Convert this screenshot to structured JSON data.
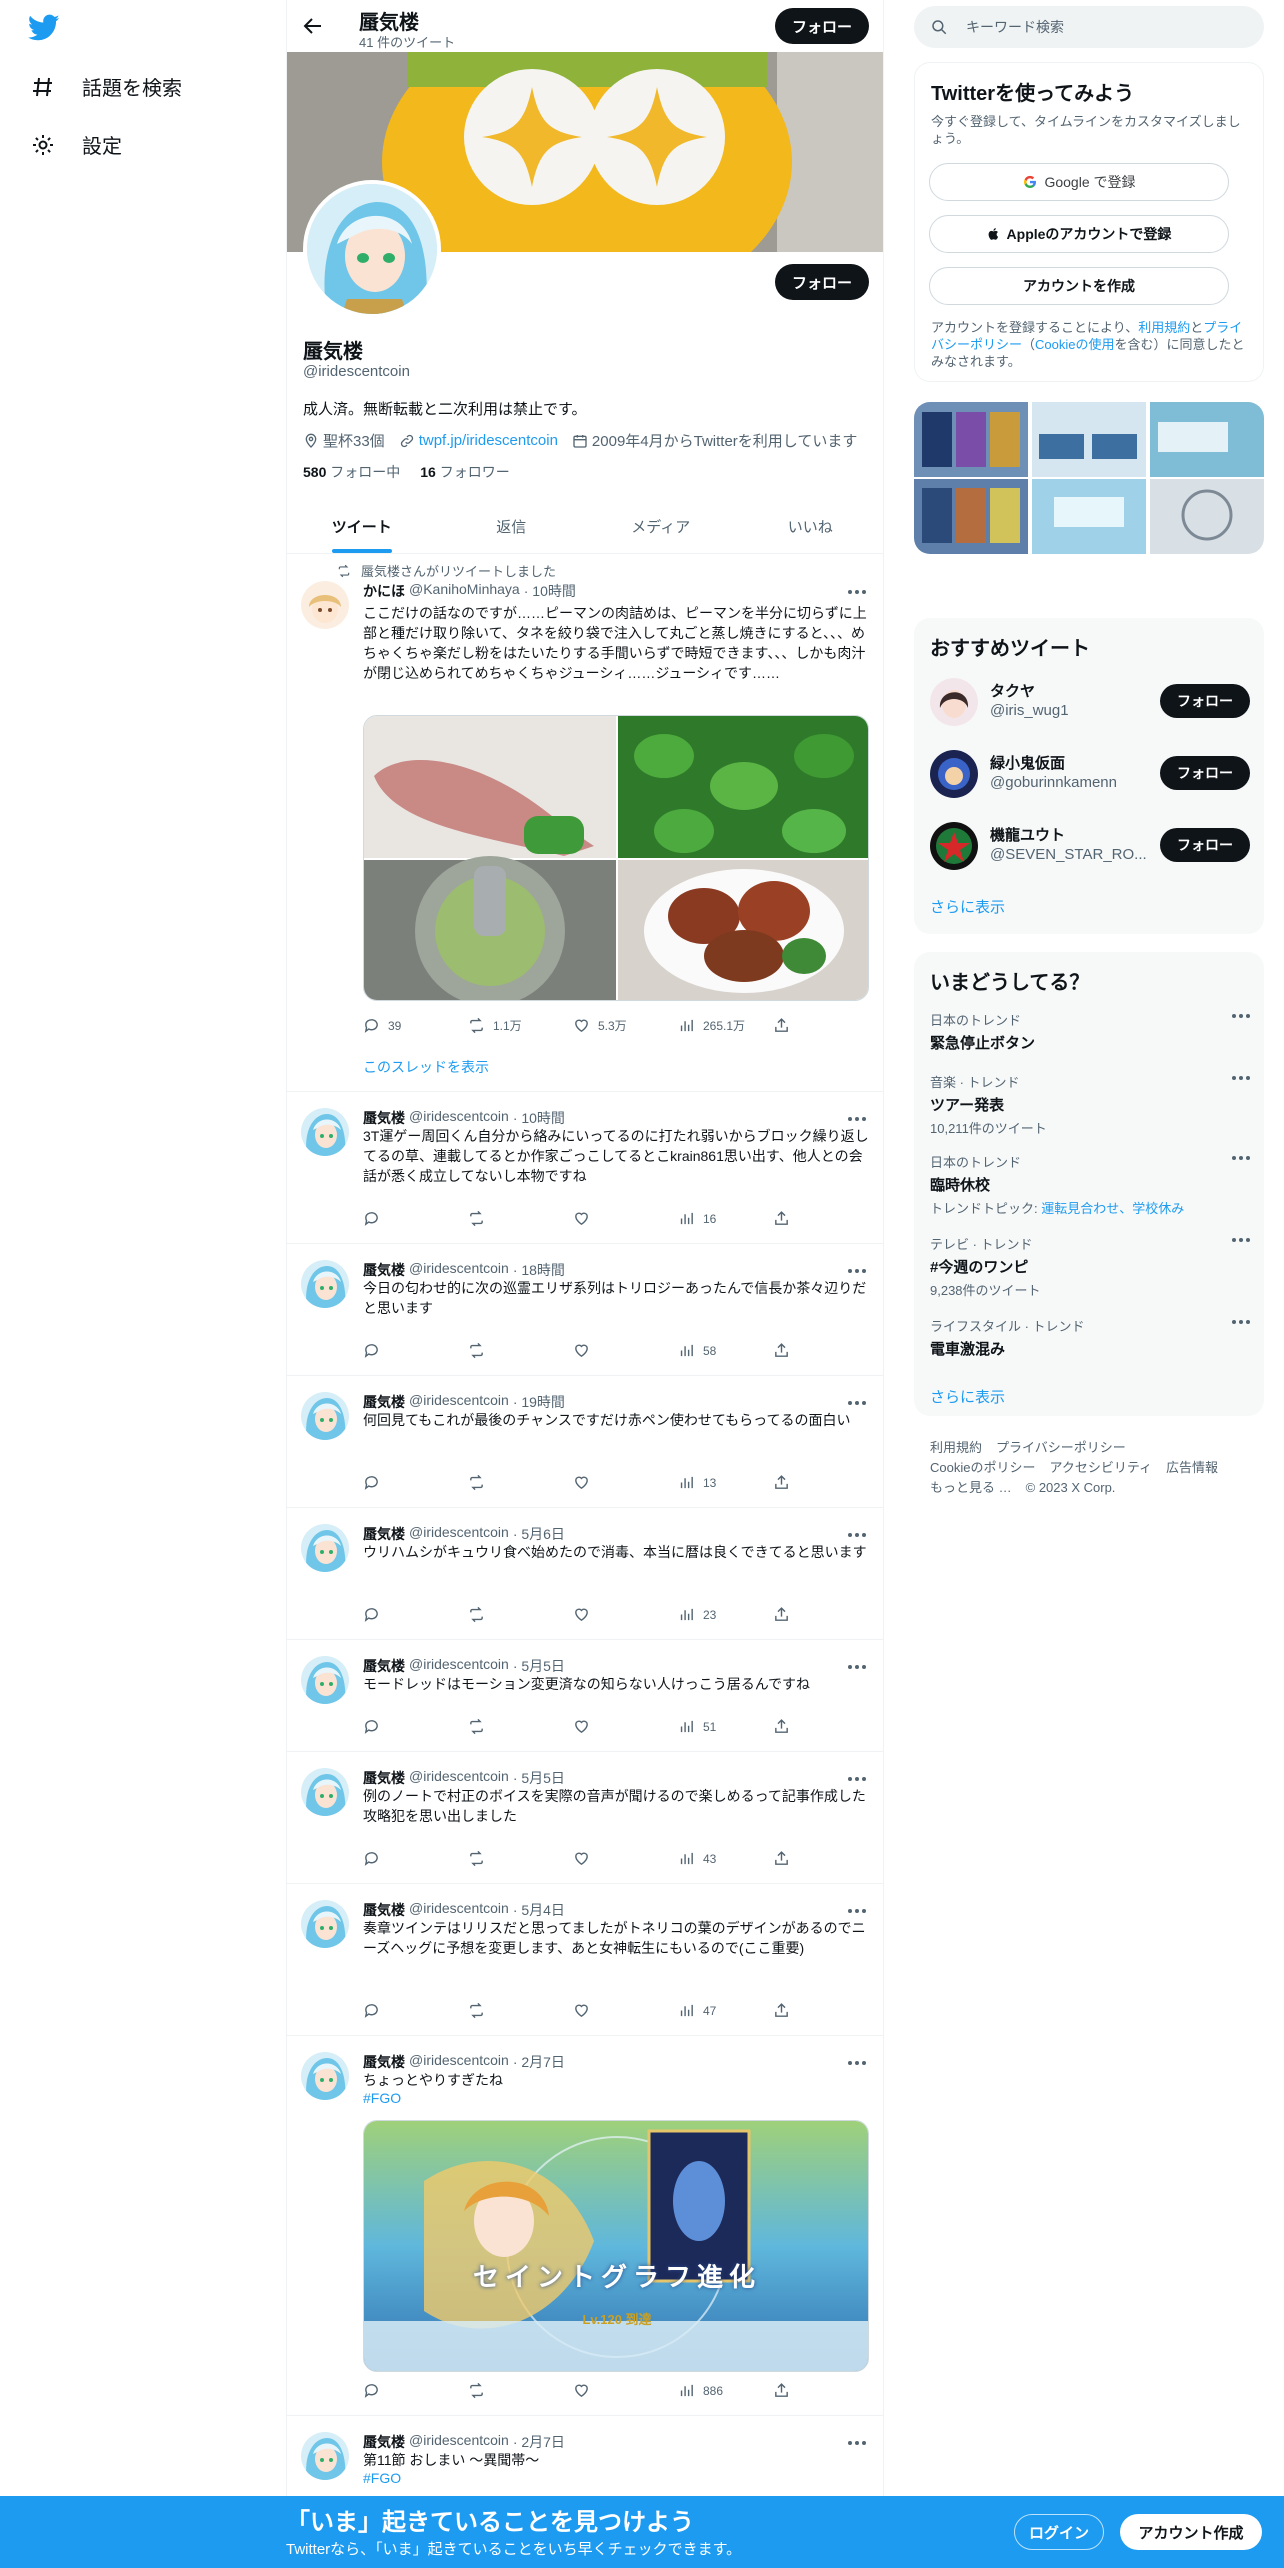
{
  "nav": {
    "items": [
      {
        "label": "話題を検索",
        "icon": "hashtag-icon"
      },
      {
        "label": "設定",
        "icon": "gear-icon"
      }
    ]
  },
  "header": {
    "title": "蜃気楼",
    "subtitle": "41 件のツイート",
    "follow_label": "フォロー"
  },
  "profile": {
    "name": "蜃気楼",
    "handle": "@iridescentcoin",
    "bio": "成人済。無断転載と二次利用は禁止です。",
    "location": "聖杯33個",
    "link": "twpf.jp/iridescentcoin",
    "joined": "2009年4月からTwitterを利用しています",
    "following_count": "580",
    "following_label": "フォロー中",
    "followers_count": "16",
    "followers_label": "フォロワー",
    "follow_label": "フォロー"
  },
  "tabs": [
    "ツイート",
    "返信",
    "メディア",
    "いいね"
  ],
  "tweets": [
    {
      "retweet_note": "蜃気楼さんがリツイートしました",
      "name": "かにほ",
      "handle": "@KanihoMinhaya",
      "time": "· 10時間",
      "text": "ここだけの話なのですが……ピーマンの肉詰めは、ピーマンを半分に切らずに上部と種だけ取り除いて、タネを絞り袋で注入して丸ごと蒸し焼きにすると、、、めちゃくちゃ楽だし粉をはたいたりする手間いらずで時短できます、、、しかも肉汁が閉じ込められてめちゃくちゃジューシィ……ジューシィです……",
      "reply": "39",
      "retweet": "1.1万",
      "like": "5.3万",
      "views": "265.1万",
      "thread_link": "このスレッドを表示"
    },
    {
      "name": "蜃気楼",
      "handle": "@iridescentcoin",
      "time": "· 10時間",
      "text": "3T運ゲー周回くん自分から絡みにいってるのに打たれ弱いからブロック繰り返してるの草、連載してるとか作家ごっこしてるとこkrain861思い出す、他人との会話が悉く成立してないし本物ですね",
      "views": "16"
    },
    {
      "name": "蜃気楼",
      "handle": "@iridescentcoin",
      "time": "· 18時間",
      "text": "今日の匂わせ的に次の巡霊エリザ系列はトリロジーあったんで信長か茶々辺りだと思います",
      "views": "58"
    },
    {
      "name": "蜃気楼",
      "handle": "@iridescentcoin",
      "time": "· 19時間",
      "text": "何回見てもこれが最後のチャンスですだけ赤ペン使わせてもらってるの面白い",
      "views": "13"
    },
    {
      "name": "蜃気楼",
      "handle": "@iridescentcoin",
      "time": "· 5月6日",
      "text": "ウリハムシがキュウリ食べ始めたので消毒、本当に暦は良くできてると思います",
      "views": "23"
    },
    {
      "name": "蜃気楼",
      "handle": "@iridescentcoin",
      "time": "· 5月5日",
      "text": "モードレッドはモーション変更済なの知らない人けっこう居るんですね",
      "views": "51"
    },
    {
      "name": "蜃気楼",
      "handle": "@iridescentcoin",
      "time": "· 5月5日",
      "text": "例のノートで村正のボイスを実際の音声が聞けるので楽しめるって記事作成した攻略犯を思い出しました",
      "views": "43"
    },
    {
      "name": "蜃気楼",
      "handle": "@iridescentcoin",
      "time": "· 5月4日",
      "text": "奏章ツインテはリリスだと思ってましたがトネリコの葉のデザインがあるのでニーズヘッグに予想を変更します、あと女神転生にもいるので(ここ重要)",
      "views": "47"
    },
    {
      "name": "蜃気楼",
      "handle": "@iridescentcoin",
      "time": "· 2月7日",
      "text": "ちょっとやりすぎたね",
      "hashtag": "#FGO",
      "media_caption": "セイントグラフ進化",
      "media_badge": "Lv.120 到達",
      "views": "886"
    },
    {
      "name": "蜃気楼",
      "handle": "@iridescentcoin",
      "time": "· 2月7日",
      "text": "第11節 おしまい ～異聞帯～",
      "hashtag": "#FGO"
    }
  ],
  "search": {
    "placeholder": "キーワード検索"
  },
  "signup": {
    "title": "Twitterを使ってみよう",
    "desc": "今すぐ登録して、タイムラインをカスタマイズしましょう。",
    "google": "Google で登録",
    "apple": "Appleのアカウントで登録",
    "create": "アカウントを作成",
    "terms_pre": "アカウントを登録することにより、",
    "terms_link1": "利用規約",
    "terms_mid": "と",
    "terms_link2": "プライバシーポリシー",
    "terms_open": "（",
    "terms_link3": "Cookieの使用",
    "terms_post": "を含む）に同意したとみなされます。"
  },
  "recommend": {
    "title": "おすすめツイート",
    "users": [
      {
        "name": "タクヤ",
        "handle": "@iris_wug1",
        "btn": "フォロー"
      },
      {
        "name": "緑小鬼仮面",
        "handle": "@goburinnkamenn",
        "btn": "フォロー"
      },
      {
        "name": "機龍ユウト",
        "handle": "@SEVEN_STAR_RO...",
        "btn": "フォロー"
      }
    ],
    "more": "さらに表示"
  },
  "trends": {
    "title": "いまどうしてる？",
    "items": [
      {
        "cat": "日本のトレンド",
        "title": "緊急停止ボタン"
      },
      {
        "cat": "音楽 · トレンド",
        "title": "ツアー発表",
        "sub": "10,211件のツイート"
      },
      {
        "cat": "日本のトレンド",
        "title": "臨時休校",
        "sub_pre": "トレンドトピック: ",
        "sub_link": "運転見合わせ、学校休み"
      },
      {
        "cat": "テレビ · トレンド",
        "title": "#今週のワンピ",
        "sub": "9,238件のツイート"
      },
      {
        "cat": "ライフスタイル · トレンド",
        "title": "電車激混み"
      }
    ],
    "more": "さらに表示"
  },
  "footer": {
    "terms": "利用規約",
    "privacy": "プライバシーポリシー",
    "cookie": "Cookieのポリシー",
    "access": "アクセシビリティ",
    "ads": "広告情報",
    "more": "もっと見る …",
    "copy": "© 2023 X Corp."
  },
  "bottombar": {
    "title": "「いま」起きていることを見つけよう",
    "sub": "Twitterなら、「いま」起きていることをいち早くチェックできます。",
    "login": "ログイン",
    "signup": "アカウント作成"
  },
  "colors": {
    "accent": "#1d9bf0",
    "dark": "#0f1419",
    "grey": "#536471"
  }
}
